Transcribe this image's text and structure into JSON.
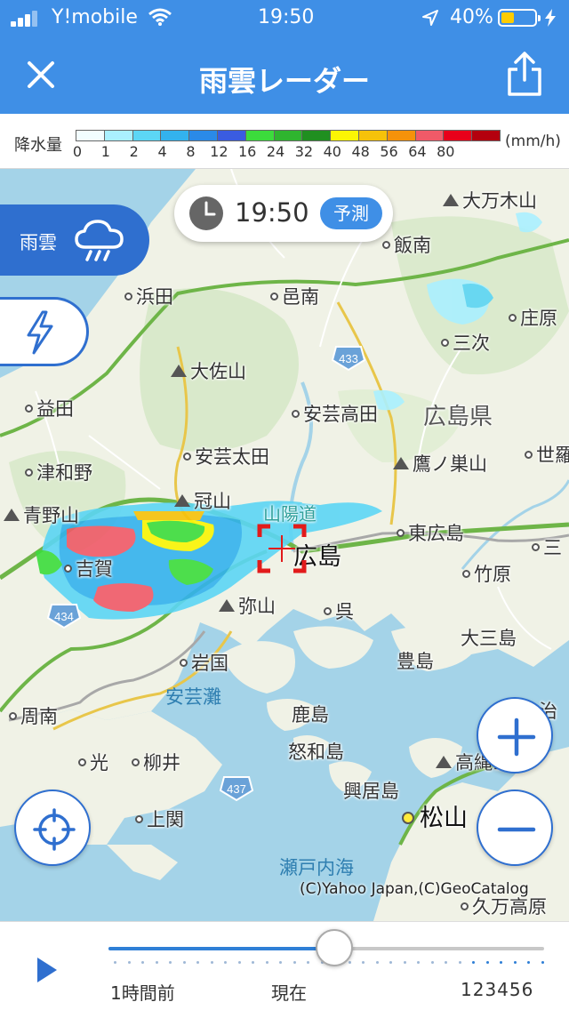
{
  "status_bar": {
    "carrier": "Y!mobile",
    "time": "19:50",
    "battery_percent_text": "40%",
    "battery_level": 0.4,
    "icons": [
      "signal-icon",
      "wifi-icon",
      "location-arrow-icon",
      "battery-icon",
      "charging-icon"
    ]
  },
  "nav": {
    "title": "雨雲レーダー",
    "close_icon": "close-icon",
    "share_icon": "share-icon"
  },
  "legend": {
    "title": "降水量",
    "unit": "(mm/h)",
    "ticks": [
      "0",
      "1",
      "2",
      "4",
      "8",
      "12",
      "16",
      "24",
      "32",
      "40",
      "48",
      "56",
      "64",
      "80"
    ],
    "colors": [
      "#f2fdff",
      "#aaf0ff",
      "#5cd6f5",
      "#33b2ee",
      "#2a8ae8",
      "#3a5ce0",
      "#3cdc3c",
      "#2fb52f",
      "#208f20",
      "#fbf504",
      "#f6c20a",
      "#f5920a",
      "#f05a68",
      "#e8001a",
      "#b4000e"
    ]
  },
  "overlay": {
    "time": "19:50",
    "forecast_badge": "予測",
    "layer_rain_label": "雨雲",
    "copyright": "(C)Yahoo Japan,(C)GeoCatalog"
  },
  "map": {
    "places": [
      {
        "name": "大万木山",
        "kind": "mtn"
      },
      {
        "name": "飯南",
        "kind": "dot"
      },
      {
        "name": "浜田",
        "kind": "dot"
      },
      {
        "name": "邑南",
        "kind": "dot"
      },
      {
        "name": "庄原",
        "kind": "dot"
      },
      {
        "name": "三次",
        "kind": "dot"
      },
      {
        "name": "大佐山",
        "kind": "mtn"
      },
      {
        "name": "益田",
        "kind": "dot"
      },
      {
        "name": "安芸高田",
        "kind": "dot"
      },
      {
        "name": "広島県",
        "kind": "pref"
      },
      {
        "name": "安芸太田",
        "kind": "dot"
      },
      {
        "name": "鷹ノ巣山",
        "kind": "mtn"
      },
      {
        "name": "世羅",
        "kind": "dot"
      },
      {
        "name": "津和野",
        "kind": "dot"
      },
      {
        "name": "冠山",
        "kind": "mtn"
      },
      {
        "name": "青野山",
        "kind": "mtn"
      },
      {
        "name": "山陽道",
        "kind": "rail"
      },
      {
        "name": "東広島",
        "kind": "dot"
      },
      {
        "name": "三",
        "kind": "dot"
      },
      {
        "name": "広島",
        "kind": "city"
      },
      {
        "name": "吉賀",
        "kind": "dot"
      },
      {
        "name": "竹原",
        "kind": "dot"
      },
      {
        "name": "弥山",
        "kind": "mtn"
      },
      {
        "name": "呉",
        "kind": "dot"
      },
      {
        "name": "大三島",
        "kind": "plain"
      },
      {
        "name": "岩国",
        "kind": "dot"
      },
      {
        "name": "豊島",
        "kind": "plain"
      },
      {
        "name": "安芸灘",
        "kind": "sea"
      },
      {
        "name": "周南",
        "kind": "dot"
      },
      {
        "name": "鹿島",
        "kind": "plain"
      },
      {
        "name": "治",
        "kind": "plain"
      },
      {
        "name": "光",
        "kind": "dot"
      },
      {
        "name": "柳井",
        "kind": "dot"
      },
      {
        "name": "怒和島",
        "kind": "plain"
      },
      {
        "name": "高縄山",
        "kind": "mtn"
      },
      {
        "name": "興居島",
        "kind": "plain"
      },
      {
        "name": "上関",
        "kind": "dot"
      },
      {
        "name": "松山",
        "kind": "major"
      },
      {
        "name": "瀬戸内海",
        "kind": "sea"
      },
      {
        "name": "久万高原",
        "kind": "dot"
      }
    ],
    "road_shields": [
      "433",
      "434",
      "437"
    ]
  },
  "controls": {
    "locate_icon": "crosshair-target-icon",
    "zoom_in_icon": "plus-icon",
    "zoom_out_icon": "minus-icon"
  },
  "playback": {
    "play_icon": "play-icon",
    "label_before": "1時間前",
    "label_now": "現在",
    "label_after": "123456",
    "position_fraction": 0.52
  }
}
